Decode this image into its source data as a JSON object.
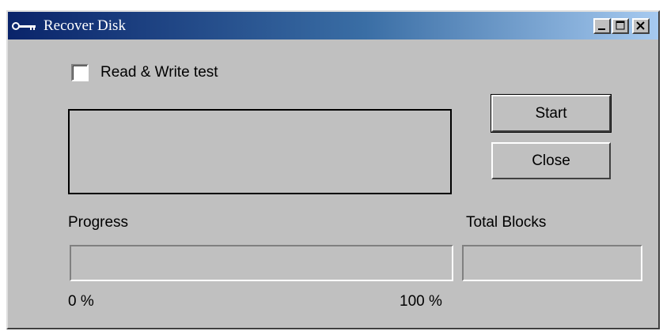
{
  "window": {
    "title": "Recover Disk",
    "icon": "key-icon",
    "controls": [
      "minimize-icon",
      "maximize-icon",
      "close-icon"
    ]
  },
  "options": {
    "read_write_test_label": "Read & Write test",
    "read_write_test_checked": false
  },
  "log": {
    "text": ""
  },
  "buttons": {
    "start_label": "Start",
    "close_label": "Close"
  },
  "progress": {
    "label": "Progress",
    "min_label": "0 %",
    "max_label": "100 %",
    "value": 0
  },
  "total_blocks": {
    "label": "Total Blocks",
    "value": ""
  },
  "colors": {
    "title_start": "#0a246a",
    "title_end": "#a6caf0",
    "face": "#c0c0c0"
  }
}
